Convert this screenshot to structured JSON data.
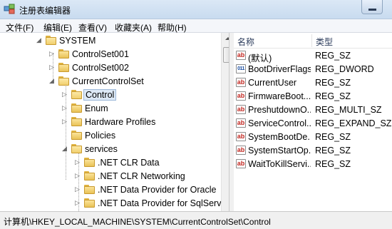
{
  "window": {
    "title": "注册表编辑器"
  },
  "menu": [
    "文件(F)",
    "编辑(E)",
    "查看(V)",
    "收藏夹(A)",
    "帮助(H)"
  ],
  "tree": {
    "items": [
      {
        "label": "SYSTEM",
        "expander": "◢",
        "open": true,
        "selected": false
      },
      {
        "label": "ControlSet001",
        "expander": "▷",
        "open": false,
        "selected": false
      },
      {
        "label": "ControlSet002",
        "expander": "▷",
        "open": false,
        "selected": false
      },
      {
        "label": "CurrentControlSet",
        "expander": "◢",
        "open": true,
        "selected": false
      },
      {
        "label": "Control",
        "expander": "▷",
        "open": false,
        "selected": true
      },
      {
        "label": "Enum",
        "expander": "▷",
        "open": false,
        "selected": false
      },
      {
        "label": "Hardware Profiles",
        "expander": "▷",
        "open": false,
        "selected": false
      },
      {
        "label": "Policies",
        "expander": "",
        "open": false,
        "selected": false
      },
      {
        "label": "services",
        "expander": "◢",
        "open": true,
        "selected": false
      },
      {
        "label": ".NET CLR Data",
        "expander": "▷",
        "open": false,
        "selected": false
      },
      {
        "label": ".NET CLR Networking",
        "expander": "▷",
        "open": false,
        "selected": false
      },
      {
        "label": ".NET Data Provider for Oracle",
        "expander": "▷",
        "open": false,
        "selected": false
      },
      {
        "label": ".NET Data Provider for SqlServer",
        "expander": "▷",
        "open": false,
        "selected": false
      }
    ]
  },
  "list": {
    "columns": {
      "name": "名称",
      "type": "类型"
    },
    "rows": [
      {
        "icon": "ab",
        "name": "(默认)",
        "type": "REG_SZ"
      },
      {
        "icon": "bin",
        "name": "BootDriverFlags",
        "type": "REG_DWORD"
      },
      {
        "icon": "ab",
        "name": "CurrentUser",
        "type": "REG_SZ"
      },
      {
        "icon": "ab",
        "name": "FirmwareBoot...",
        "type": "REG_SZ"
      },
      {
        "icon": "ab",
        "name": "PreshutdownO...",
        "type": "REG_MULTI_SZ"
      },
      {
        "icon": "ab",
        "name": "ServiceControl...",
        "type": "REG_EXPAND_SZ"
      },
      {
        "icon": "ab",
        "name": "SystemBootDe...",
        "type": "REG_SZ"
      },
      {
        "icon": "ab",
        "name": "SystemStartOp...",
        "type": "REG_SZ"
      },
      {
        "icon": "ab",
        "name": "WaitToKillServi...",
        "type": "REG_SZ"
      }
    ]
  },
  "status": {
    "path": "计算机\\HKEY_LOCAL_MACHINE\\SYSTEM\\CurrentControlSet\\Control"
  }
}
